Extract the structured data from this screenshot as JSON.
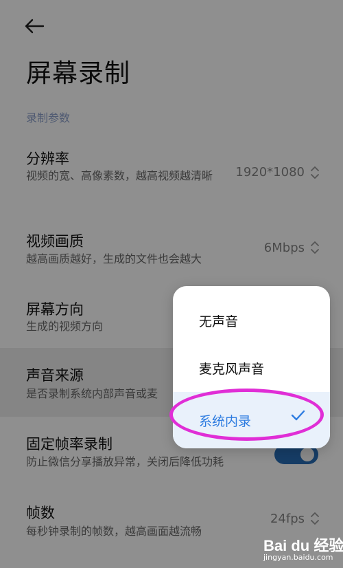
{
  "header": {
    "title": "屏幕录制"
  },
  "section": {
    "label": "录制参数"
  },
  "settings": [
    {
      "title": "分辨率",
      "desc": "视频的宽、高像素数，越高视频越清晰",
      "value": "1920*1080"
    },
    {
      "title": "视频画质",
      "desc": "越高画质越好，生成的文件也会越大",
      "value": "6Mbps"
    },
    {
      "title": "屏幕方向",
      "desc": "生成的视频方向"
    },
    {
      "title": "声音来源",
      "desc": "是否录制系统内部声音或麦"
    },
    {
      "title": "固定帧率录制",
      "desc": "防止微信分享播放异常，关闭后降低功耗",
      "toggle_on": true
    },
    {
      "title": "帧数",
      "desc": "每秒钟录制的帧数，越高画面越流畅",
      "value": "24fps"
    }
  ],
  "audio_source_menu": {
    "options": [
      {
        "label": "无声音",
        "selected": false
      },
      {
        "label": "麦克风声音",
        "selected": false
      },
      {
        "label": "系统内录",
        "selected": true
      }
    ]
  },
  "colors": {
    "accent": "#2c7be0",
    "annotation": "#e02ed6",
    "toggle": "#163d66"
  },
  "watermark": {
    "brand": "Bai du 经验",
    "url": "jingyan.baidu.com"
  }
}
